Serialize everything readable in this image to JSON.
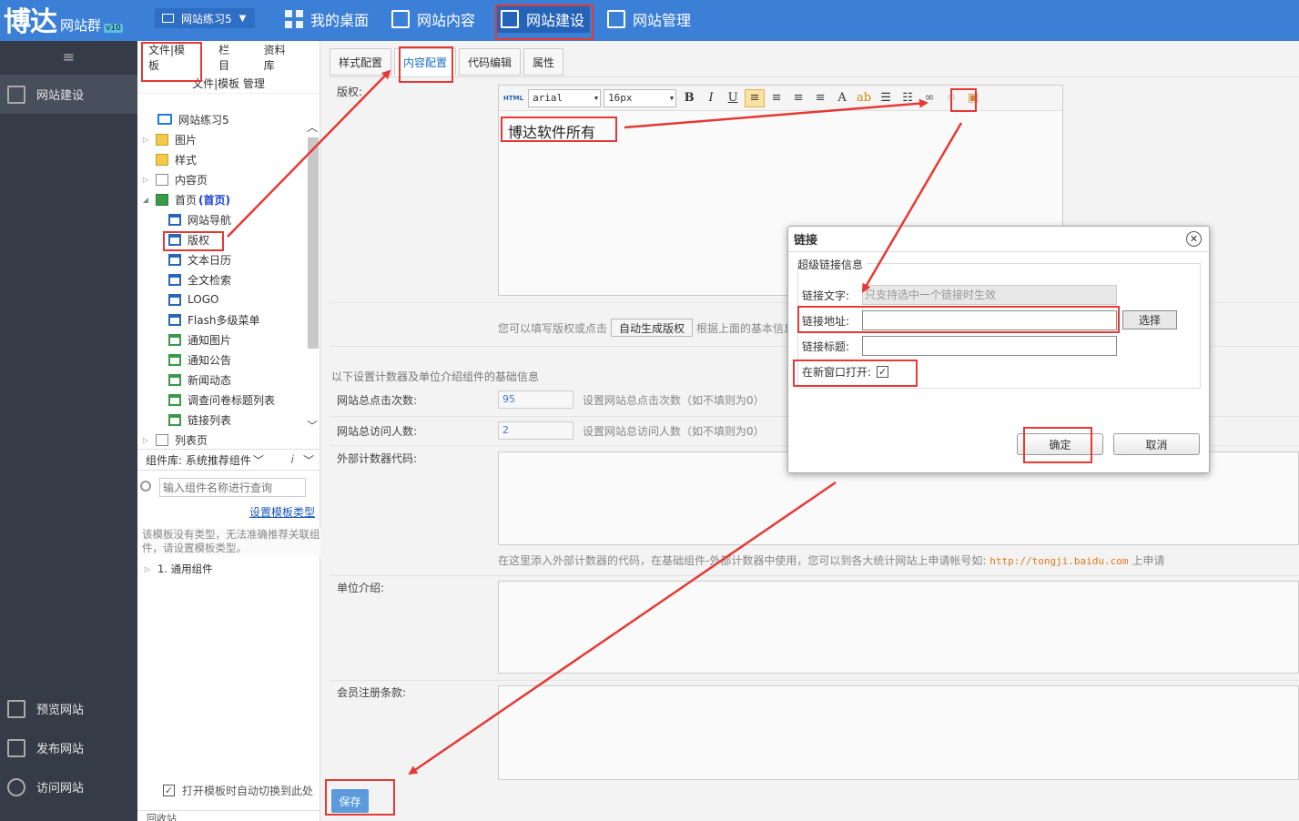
{
  "topbar": {
    "logo_main": "博达",
    "logo_sub": "网站群",
    "logo_ver": "v10",
    "site_select": "网站练习5",
    "nav": [
      {
        "label": "我的桌面",
        "icon": "desktop-icon"
      },
      {
        "label": "网站内容",
        "icon": "edit-icon"
      },
      {
        "label": "网站建设",
        "icon": "build-icon"
      },
      {
        "label": "网站管理",
        "icon": "manage-icon"
      }
    ]
  },
  "sidebar": {
    "collapse_icon": "≡",
    "items": [
      {
        "label": "网站建设",
        "icon": "build-icon"
      },
      {
        "label": "预览网站",
        "icon": "preview-icon"
      },
      {
        "label": "发布网站",
        "icon": "publish-icon"
      },
      {
        "label": "访问网站",
        "icon": "visit-icon"
      }
    ]
  },
  "tree_panel": {
    "tabs": [
      "文件|模板",
      "栏目",
      "资料库"
    ],
    "title": "文件|模板 管理",
    "tree": [
      {
        "label": "网站练习5",
        "arrow": "",
        "icon": "monitor"
      },
      {
        "label": "图片",
        "arrow": "▷",
        "icon": "folder"
      },
      {
        "label": "样式",
        "arrow": "",
        "icon": "folder"
      },
      {
        "label": "内容页",
        "arrow": "▷",
        "icon": "page"
      },
      {
        "label": "首页",
        "arrow": "◢",
        "icon": "home",
        "tag": "(首页)"
      },
      {
        "label": "网站导航",
        "arrow": "",
        "icon": "comp",
        "indent": 1
      },
      {
        "label": "版权",
        "arrow": "",
        "icon": "comp",
        "indent": 1
      },
      {
        "label": "文本日历",
        "arrow": "",
        "icon": "comp",
        "indent": 1
      },
      {
        "label": "全文检索",
        "arrow": "",
        "icon": "comp",
        "indent": 1
      },
      {
        "label": "LOGO",
        "arrow": "",
        "icon": "comp",
        "indent": 1
      },
      {
        "label": "Flash多级菜单",
        "arrow": "",
        "icon": "comp",
        "indent": 1
      },
      {
        "label": "通知图片",
        "arrow": "",
        "icon": "comp-g",
        "indent": 1
      },
      {
        "label": "通知公告",
        "arrow": "",
        "icon": "comp-g",
        "indent": 1
      },
      {
        "label": "新闻动态",
        "arrow": "",
        "icon": "comp-g",
        "indent": 1
      },
      {
        "label": "调查问卷标题列表",
        "arrow": "",
        "icon": "comp-g",
        "indent": 1
      },
      {
        "label": "链接列表",
        "arrow": "",
        "icon": "comp-g",
        "indent": 1
      },
      {
        "label": "列表页",
        "arrow": "▷",
        "icon": "page"
      }
    ],
    "comp_lib": "组件库: 系统推荐组件",
    "search_placeholder": "输入组件名称进行查询",
    "set_type_link": "设置模板类型",
    "note": "该模板没有类型，无法准确推荐关联组件，请设置模板类型。",
    "group_label": "1. 通用组件",
    "auto_switch": "打开模板时自动切换到此处",
    "bottom_label": "回收站"
  },
  "main": {
    "tabs": [
      "样式配置",
      "内容配置",
      "代码编辑",
      "属性"
    ],
    "copyright_label": "版权:",
    "toolbar": {
      "font": "arial",
      "size": "16px",
      "buttons": [
        "B",
        "I",
        "U"
      ]
    },
    "editor_text": "博达软件所有",
    "hint1_pre": "您可以填写版权或点击",
    "gen_button": "自动生成版权",
    "hint1_post": "根据上面的基本信息",
    "section_note": "以下设置计数器及单位介绍组件的基础信息",
    "clicks_label": "网站总点击次数:",
    "clicks_value": "95",
    "clicks_hint": "设置网站总点击次数（如不填则为0）",
    "visitors_label": "网站总访问人数:",
    "visitors_value": "2",
    "visitors_hint": "设置网站总访问人数（如不填则为0）",
    "counter_label": "外部计数器代码:",
    "counter_hint_pre": "在这里添入外部计数器的代码，在基础组件-外部计数器中使用，您可以到各大统计网站上申请帐号如:",
    "counter_hint_url": "http://tongji.baidu.com",
    "counter_hint_post": "上申请",
    "unit_label": "单位介绍:",
    "member_label": "会员注册条款:",
    "save_button": "保存"
  },
  "dialog": {
    "title": "链接",
    "close": "✕",
    "legend": "超级链接信息",
    "text_label": "链接文字:",
    "text_placeholder": "只支持选中一个链接时生效",
    "url_label": "链接地址:",
    "url_value": "",
    "choose_button": "选择",
    "title_label": "链接标题:",
    "title_value": "",
    "new_window_label": "在新窗口打开:",
    "ok_button": "确定",
    "cancel_button": "取消"
  },
  "colors": {
    "topbar": "#3b7fd6",
    "sidebar": "#353b47",
    "annotation": "#e53935",
    "link": "#1a55c2"
  }
}
